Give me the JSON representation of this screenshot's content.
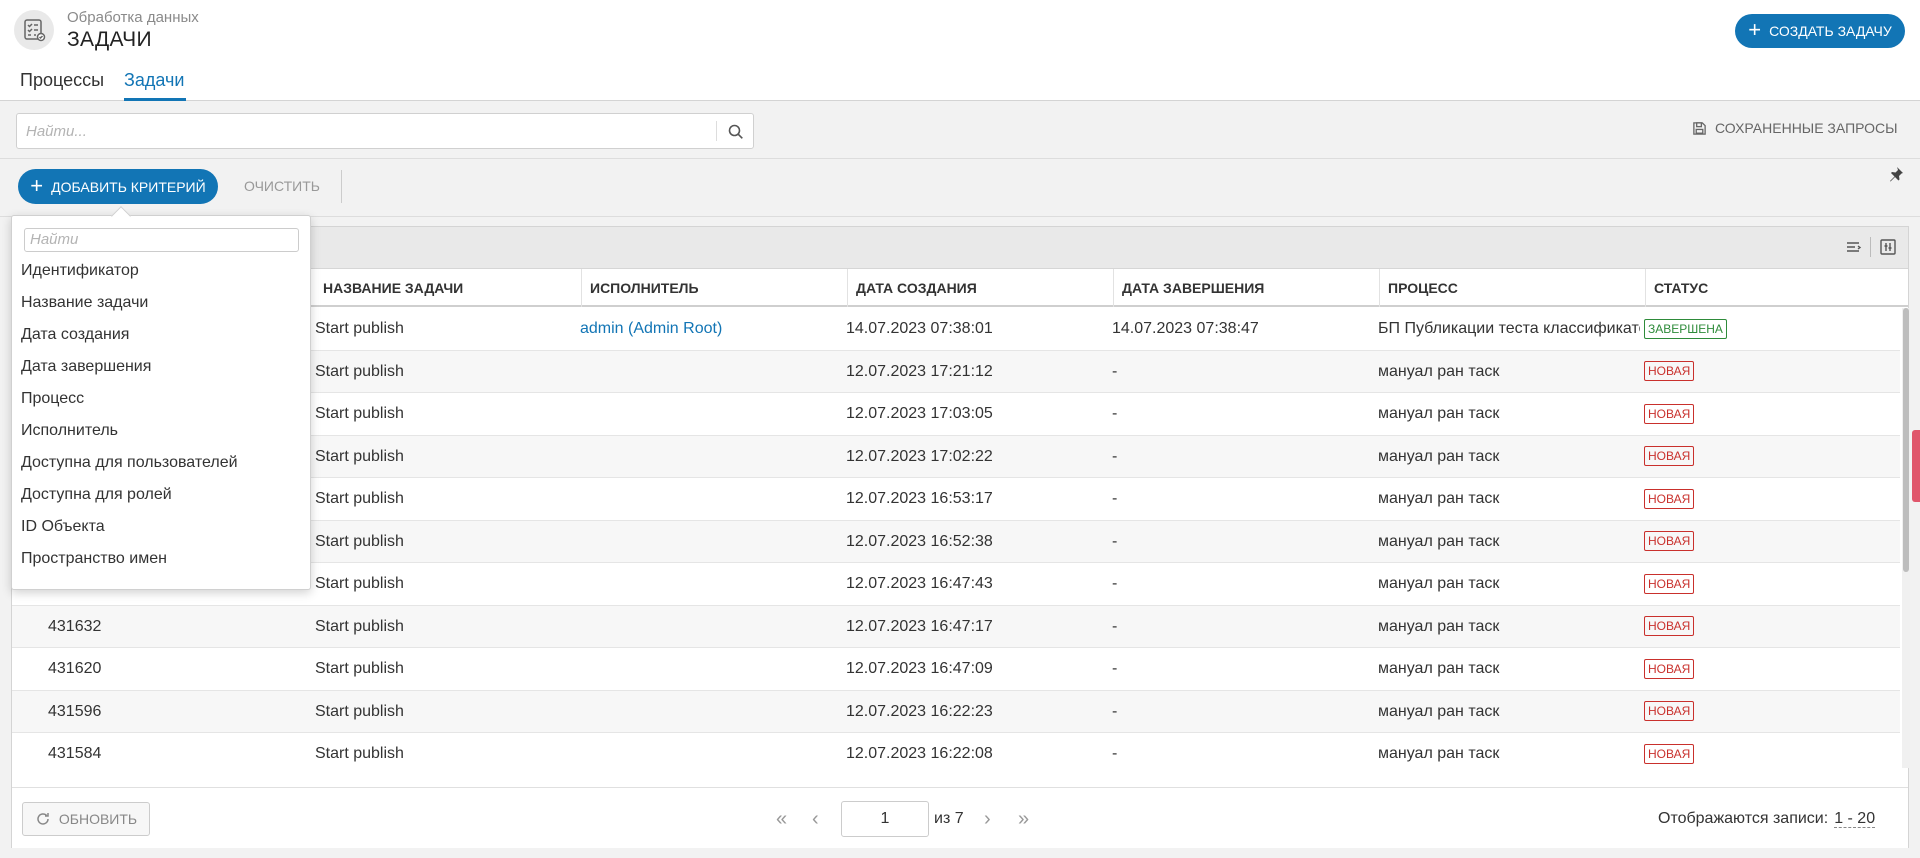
{
  "header": {
    "subtitle": "Обработка данных",
    "title": "ЗАДАЧИ",
    "create_label": "СОЗДАТЬ ЗАДАЧУ",
    "tabs": [
      {
        "label": "Процессы",
        "active": false
      },
      {
        "label": "Задачи",
        "active": true
      }
    ]
  },
  "search": {
    "placeholder": "Найти...",
    "saved_queries_label": "СОХРАНЕННЫЕ ЗАПРОСЫ"
  },
  "criteria": {
    "add_label": "ДОБАВИТЬ КРИТЕРИЙ",
    "clear_label": "ОЧИСТИТЬ"
  },
  "dropdown": {
    "search_placeholder": "Найти",
    "items": [
      "Идентификатор",
      "Название задачи",
      "Дата создания",
      "Дата завершения",
      "Процесс",
      "Исполнитель",
      "Доступна для пользователей",
      "Доступна для ролей",
      "ID Объекта",
      "Пространство имен"
    ]
  },
  "table": {
    "columns": [
      "НАЗВАНИЕ ЗАДАЧИ",
      "ИСПОЛНИТЕЛЬ",
      "ДАТА СОЗДАНИЯ",
      "ДАТА ЗАВЕРШЕНИЯ",
      "ПРОЦЕСС",
      "СТАТУС"
    ],
    "rows": [
      {
        "id": "",
        "name": "Start publish",
        "assignee": "admin (Admin Root)",
        "created": "14.07.2023 07:38:01",
        "finished": "14.07.2023 07:38:47",
        "process": "БП Публикации теста классификатора",
        "status": "ЗАВЕРШЕНА",
        "status_type": "done"
      },
      {
        "id": "",
        "name": "Start publish",
        "assignee": "",
        "created": "12.07.2023 17:21:12",
        "finished": "-",
        "process": "мануал ран таск",
        "status": "НОВАЯ",
        "status_type": "new"
      },
      {
        "id": "",
        "name": "Start publish",
        "assignee": "",
        "created": "12.07.2023 17:03:05",
        "finished": "-",
        "process": "мануал ран таск",
        "status": "НОВАЯ",
        "status_type": "new"
      },
      {
        "id": "",
        "name": "Start publish",
        "assignee": "",
        "created": "12.07.2023 17:02:22",
        "finished": "-",
        "process": "мануал ран таск",
        "status": "НОВАЯ",
        "status_type": "new"
      },
      {
        "id": "",
        "name": "Start publish",
        "assignee": "",
        "created": "12.07.2023 16:53:17",
        "finished": "-",
        "process": "мануал ран таск",
        "status": "НОВАЯ",
        "status_type": "new"
      },
      {
        "id": "",
        "name": "Start publish",
        "assignee": "",
        "created": "12.07.2023 16:52:38",
        "finished": "-",
        "process": "мануал ран таск",
        "status": "НОВАЯ",
        "status_type": "new"
      },
      {
        "id": "",
        "name": "Start publish",
        "assignee": "",
        "created": "12.07.2023 16:47:43",
        "finished": "-",
        "process": "мануал ран таск",
        "status": "НОВАЯ",
        "status_type": "new"
      },
      {
        "id": "431632",
        "name": "Start publish",
        "assignee": "",
        "created": "12.07.2023 16:47:17",
        "finished": "-",
        "process": "мануал ран таск",
        "status": "НОВАЯ",
        "status_type": "new"
      },
      {
        "id": "431620",
        "name": "Start publish",
        "assignee": "",
        "created": "12.07.2023 16:47:09",
        "finished": "-",
        "process": "мануал ран таск",
        "status": "НОВАЯ",
        "status_type": "new"
      },
      {
        "id": "431596",
        "name": "Start publish",
        "assignee": "",
        "created": "12.07.2023 16:22:23",
        "finished": "-",
        "process": "мануал ран таск",
        "status": "НОВАЯ",
        "status_type": "new"
      },
      {
        "id": "431584",
        "name": "Start publish",
        "assignee": "",
        "created": "12.07.2023 16:22:08",
        "finished": "-",
        "process": "мануал ран таск",
        "status": "НОВАЯ",
        "status_type": "new"
      }
    ]
  },
  "footer": {
    "refresh_label": "ОБНОВИТЬ",
    "page": "1",
    "page_of": "из 7",
    "records_label": "Отображаются записи:",
    "records_range": "1 - 20"
  },
  "colors": {
    "accent": "#1275b5",
    "status_new": "#c9302c",
    "status_done": "#2e8b3a"
  }
}
